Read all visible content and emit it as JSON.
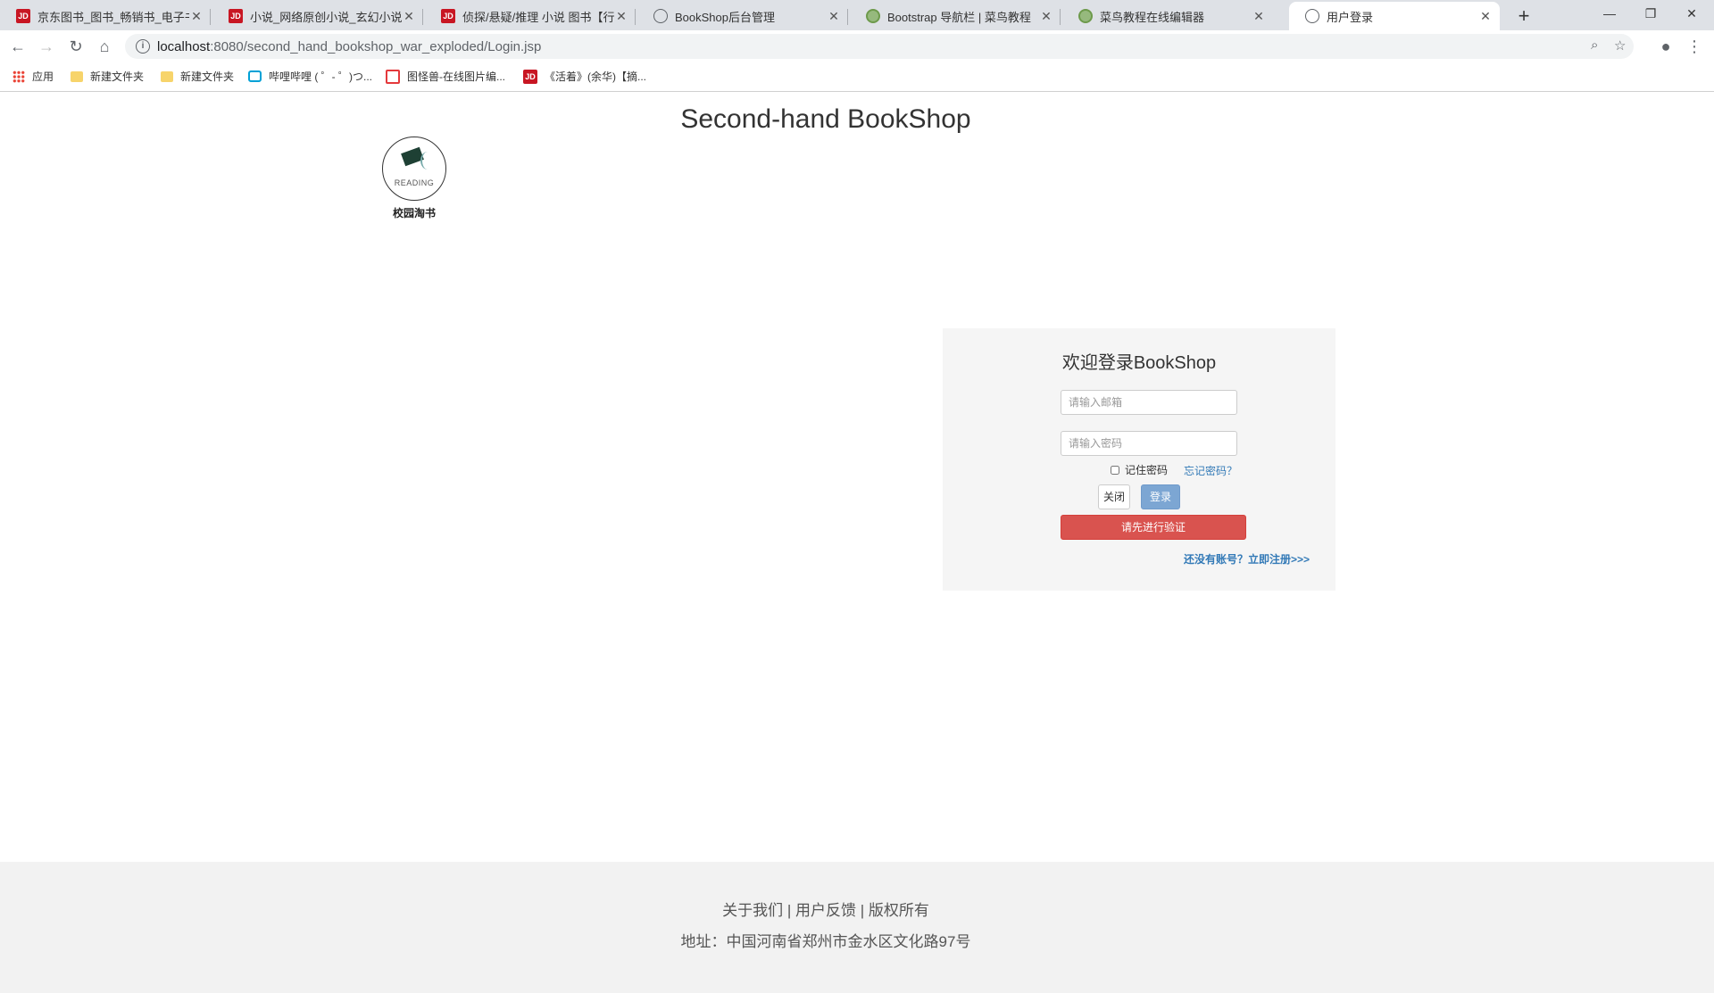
{
  "browser": {
    "tabs": [
      {
        "title": "京东图书_图书_畅销书_电子书_新",
        "icon": "jd-icon"
      },
      {
        "title": "小说_网络原创小说_玄幻小说-图",
        "icon": "jd-icon"
      },
      {
        "title": "侦探/悬疑/推理 小说 图书【行情",
        "icon": "jd-icon"
      },
      {
        "title": "BookShop后台管理",
        "icon": "globe-icon"
      },
      {
        "title": "Bootstrap 导航栏 | 菜鸟教程",
        "icon": "runoob-icon"
      },
      {
        "title": "菜鸟教程在线编辑器",
        "icon": "runoob-icon"
      },
      {
        "title": "用户登录",
        "icon": "globe-icon",
        "active": true
      }
    ],
    "url_host": "localhost",
    "url_path": ":8080/second_hand_bookshop_war_exploded/Login.jsp",
    "bookmarks": [
      {
        "label": "应用",
        "icon": "apps-icon"
      },
      {
        "label": "新建文件夹",
        "icon": "folder-icon"
      },
      {
        "label": "新建文件夹",
        "icon": "folder-icon"
      },
      {
        "label": "哔哩哔哩 ( ゜- ゜)つ...",
        "icon": "bilibili-icon"
      },
      {
        "label": "图怪兽-在线图片编...",
        "icon": "tuguaishou-icon"
      },
      {
        "label": "《活着》(余华)【摘...",
        "icon": "jd-icon"
      }
    ]
  },
  "page": {
    "site_title": "Second-hand BookShop",
    "logo_word": "READING",
    "logo_caption": "校园淘书"
  },
  "login": {
    "title": "欢迎登录BookShop",
    "email_placeholder": "请输入邮箱",
    "password_placeholder": "请输入密码",
    "remember_label": "记住密码",
    "forgot_label": "忘记密码？",
    "close_label": "关闭",
    "login_label": "登录",
    "verify_label": "请先进行验证",
    "register_label": "还没有账号？立即注册>>>"
  },
  "footer": {
    "links": "关于我们 | 用户反馈 | 版权所有",
    "address": "地址：中国河南省郑州市金水区文化路97号"
  }
}
